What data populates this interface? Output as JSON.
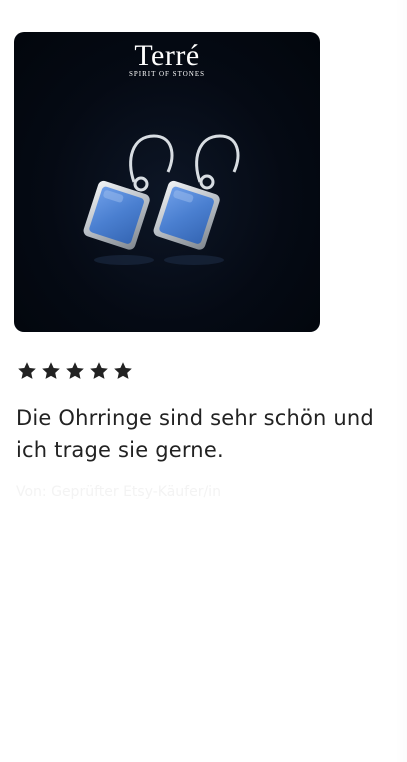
{
  "review": {
    "brand_logo_text": "Terré",
    "brand_tagline": "SPIRIT OF STONES",
    "rating_stars": 5,
    "rating_max": 5,
    "text": "Die Ohrringe sind sehr schön und ich trage sie gerne.",
    "purchase_note": "Von: Geprüfter Etsy-Käufer/in"
  },
  "colors": {
    "image_background": "#040a14",
    "stone": "#4a7fd0",
    "silver": "#c8cdd3",
    "star": "#222222",
    "text": "#222222"
  }
}
